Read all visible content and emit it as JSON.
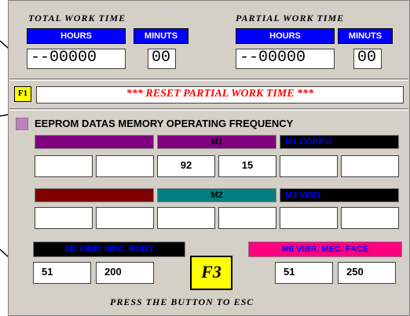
{
  "total": {
    "title": "TOTAL WORK TIME",
    "hours_label": "HOURS",
    "minuts_label": "MINUTS",
    "hours_value": "--00000",
    "minuts_value": "00"
  },
  "partial": {
    "title": "PARTIAL WORK TIME",
    "hours_label": "HOURS",
    "minuts_label": "MINUTS",
    "hours_value": "--00000",
    "minuts_value": "00"
  },
  "reset": {
    "key": "F1",
    "label": "*** RESET PARTIAL WORK TIME ***"
  },
  "eeprom": {
    "title": "EEPROM DATAS MEMORY OPERATING FREQUENCY"
  },
  "row1": {
    "bars": [
      {
        "label": "",
        "color": "#800080"
      },
      {
        "label": "M1",
        "color": "#800080"
      },
      {
        "label": "M1 CORPO",
        "color": "#000000"
      }
    ],
    "values": [
      "",
      "",
      "92",
      "15",
      "",
      ""
    ]
  },
  "row2": {
    "bars": [
      {
        "label": "",
        "color": "#800000"
      },
      {
        "label": "M2",
        "color": "#008080"
      },
      {
        "label": "M2  VISO",
        "color": "#000000"
      }
    ],
    "values": [
      "",
      "",
      "",
      "",
      "",
      ""
    ]
  },
  "m5": {
    "label": "M5 VIBR. MEC. BODY",
    "v1": "51",
    "v2": "200"
  },
  "m6": {
    "label": "M6  VIBR. MEC. FACE",
    "v1": "51",
    "v2": "250"
  },
  "f3": {
    "label": "F3"
  },
  "footer": {
    "text": "PRESS THE BUTTON TO ESC"
  },
  "colors": {
    "panel": "#d4d0c8",
    "label_blue": "#0000ff",
    "reset_red": "#ff0000",
    "m5_text": "#0000ff",
    "m6_bg": "#ff0080",
    "section_square": "#c080c0"
  }
}
